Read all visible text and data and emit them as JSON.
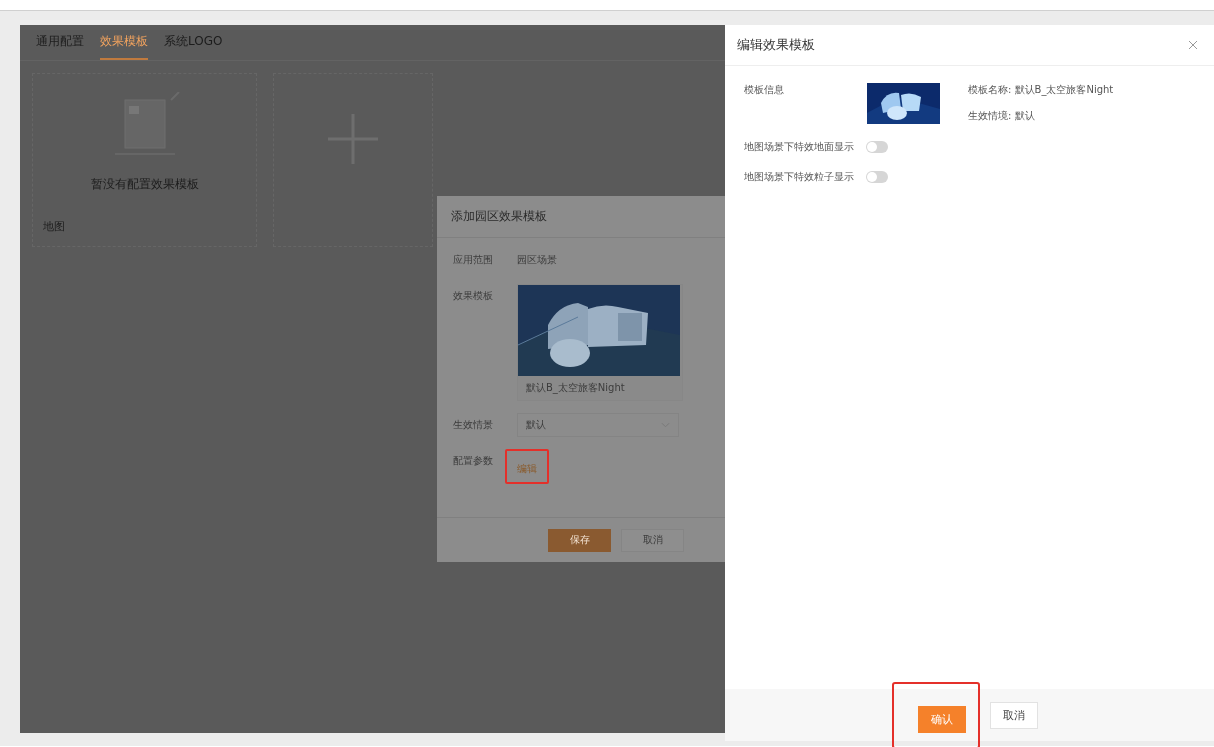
{
  "tabs": [
    {
      "label": "通用配置",
      "selected": false
    },
    {
      "label": "效果模板",
      "selected": true
    },
    {
      "label": "系统LOGO",
      "selected": false
    }
  ],
  "template_cards": [
    {
      "kind": "empty",
      "message": "暂没有配置效果模板",
      "tag": "地图"
    },
    {
      "kind": "add"
    }
  ],
  "modal": {
    "title": "添加园区效果模板",
    "fields": [
      {
        "kind": "text",
        "label": "应用范围",
        "value": "园区场景"
      },
      {
        "kind": "template",
        "label": "效果模板",
        "caption": "默认B_太空旅客Night"
      },
      {
        "kind": "select",
        "label": "生效情景",
        "value": "默认"
      },
      {
        "kind": "link",
        "label": "配置参数",
        "value": "编辑",
        "highlighted": true
      }
    ],
    "buttons": [
      {
        "label": "保存",
        "primary": true
      },
      {
        "label": "取消",
        "primary": false
      }
    ]
  },
  "drawer": {
    "title": "编辑效果模板",
    "info_label": "模板信息",
    "info_lines": [
      "模板名称: 默认B_太空旅客Night",
      "生效情境: 默认"
    ],
    "toggles": [
      {
        "label": "地图场景下特效地面显示",
        "on": false
      },
      {
        "label": "地图场景下特效粒子显示",
        "on": false
      }
    ],
    "buttons": [
      {
        "label": "确认",
        "primary": true,
        "highlighted": true
      },
      {
        "label": "取消",
        "primary": false,
        "highlighted": false
      }
    ]
  }
}
